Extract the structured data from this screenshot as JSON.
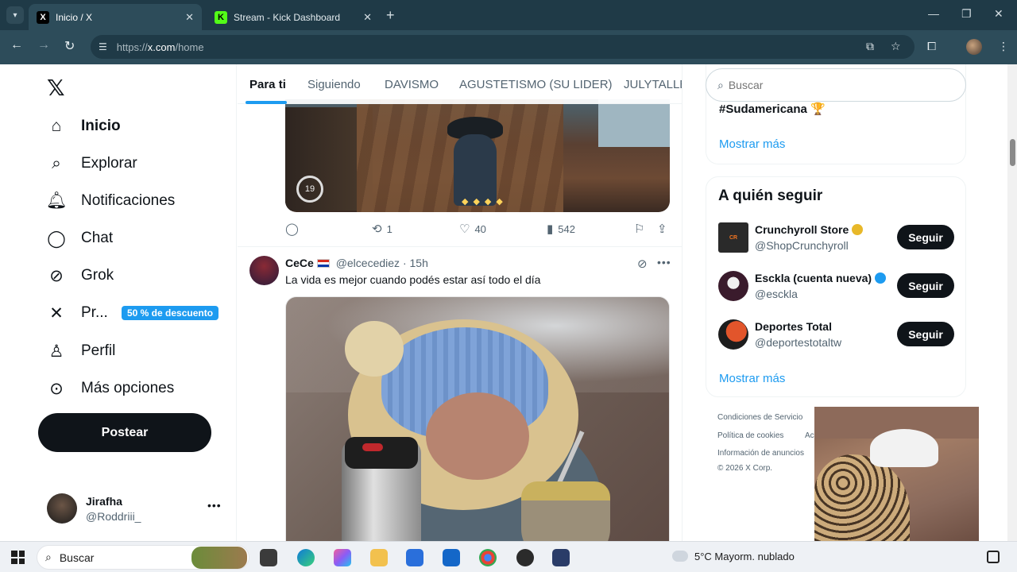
{
  "browser": {
    "tabs": [
      {
        "title": "Inicio / X",
        "favicon": "x-logo-icon",
        "active": true
      },
      {
        "title": "Stream - Kick Dashboard",
        "favicon": "kick-logo-icon",
        "active": false
      }
    ],
    "url_prefix": "https://",
    "url_domain": "x.com",
    "url_path": "/home"
  },
  "sidebar": {
    "items": [
      {
        "label": "Inicio",
        "icon": "home-icon"
      },
      {
        "label": "Explorar",
        "icon": "search-icon"
      },
      {
        "label": "Notificaciones",
        "icon": "bell-icon"
      },
      {
        "label": "Chat",
        "icon": "chat-bubble-icon"
      },
      {
        "label": "Grok",
        "icon": "grok-icon"
      },
      {
        "label": "Pr...",
        "icon": "x-premium-icon"
      },
      {
        "label": "Perfil",
        "icon": "person-icon"
      },
      {
        "label": "Más opciones",
        "icon": "more-circle-icon"
      }
    ],
    "promo_badge": "50 % de descuento",
    "post_button": "Postear",
    "account": {
      "name": "Jirafha",
      "handle": "@Roddriii_"
    }
  },
  "feed": {
    "tabs": [
      "Para ti",
      "Siguiendo",
      "DAVISMO",
      "AGUSTETISMO (SU LIDER)",
      "JULYTALLER"
    ],
    "active_tab": "Para ti",
    "post1": {
      "media_hud_value": "19",
      "reposts": "1",
      "likes": "40",
      "views": "542"
    },
    "post2": {
      "author": "CeCe",
      "handle": "@elcecediez",
      "time": "· 15h",
      "text": "La vida es mejor cuando podés estar así todo el día"
    }
  },
  "right": {
    "search_placeholder": "Buscar",
    "trend": "#Sudamericana 🏆",
    "show_more": "Mostrar más",
    "who_to_follow": {
      "title": "A quién seguir",
      "accounts": [
        {
          "name": "Crunchyroll Store",
          "handle": "@ShopCrunchyroll",
          "verified": "gold"
        },
        {
          "name": "Esckla (cuenta nueva)",
          "handle": "@esckla",
          "verified": "blue"
        },
        {
          "name": "Deportes Total",
          "handle": "@deportestotaltw",
          "verified": "none"
        }
      ],
      "follow_label": "Seguir",
      "show_more": "Mostrar más"
    },
    "footer": {
      "line1": "Condiciones de Servicio",
      "line2a": "Política de cookies",
      "line2b": "Ac",
      "line3": "Información de anuncios",
      "copyright": "© 2026 X Corp."
    }
  },
  "taskbar": {
    "search_label": "Buscar",
    "weather": "5°C  Mayorm. nublado"
  },
  "colors": {
    "accent": "#1d9bf0",
    "chrome_bg": "#1f3a47",
    "toolbar_bg": "#2d4c5a",
    "text_primary": "#0f1419",
    "text_secondary": "#536471"
  }
}
